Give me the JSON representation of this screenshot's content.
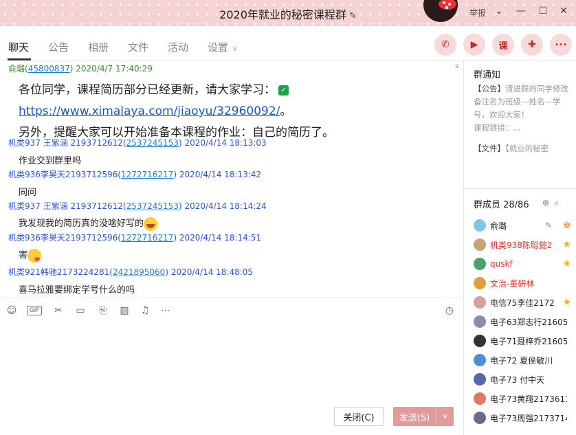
{
  "window": {
    "title": "2020年就业的秘密课程群",
    "edit_icon": "pencil-icon",
    "report_label": "举报",
    "controls": [
      "chevron-down-icon",
      "minimize-icon",
      "maximize-icon",
      "close-icon"
    ]
  },
  "tabs": [
    {
      "label": "聊天",
      "active": true
    },
    {
      "label": "公告",
      "active": false
    },
    {
      "label": "相册",
      "active": false
    },
    {
      "label": "文件",
      "active": false
    },
    {
      "label": "活动",
      "active": false
    },
    {
      "label": "设置",
      "active": false
    }
  ],
  "toolbar_buttons": [
    {
      "icon": "phone-icon",
      "glyph": "✆"
    },
    {
      "icon": "video-icon",
      "glyph": "▶"
    },
    {
      "icon": "course-icon",
      "glyph": "课"
    },
    {
      "icon": "add-chat-icon",
      "glyph": "✚"
    },
    {
      "icon": "more-icon",
      "glyph": "•••"
    }
  ],
  "messages": [
    {
      "sender": "俞璐",
      "qq": "45800837",
      "time": "2020/4/7 17:40:29",
      "line1": "各位同学，课程简历部分已经更新，请大家学习：",
      "link": "https://www.ximalaya.com/jiaoyu/32960092/",
      "line1_suffix": "。",
      "line2": "另外，提醒大家可以开始准备本课程的作业：自己的简历了。"
    },
    {
      "sender": "机类937 王紫涵 2193712612",
      "qq": "2537245153",
      "time": "2020/4/14 18:13:03",
      "text": "作业交到群里吗"
    },
    {
      "sender": "机类936李昊天2193712596",
      "qq": "1272716217",
      "time": "2020/4/14 18:13:42",
      "text": "同问"
    },
    {
      "sender": "机类937 王紫涵 2193712612",
      "qq": "2537245153",
      "time": "2020/4/14 18:14:24",
      "text": "我发现我的简历真的没啥好写的"
    },
    {
      "sender": "机类936李昊天2193712596",
      "qq": "1272716217",
      "time": "2020/4/14 18:14:51",
      "text": "害"
    },
    {
      "sender": "机类921韩驰2173224281",
      "qq": "2421895060",
      "time": "2020/4/14 18:48:05",
      "text": "喜马拉雅要绑定学号什么的吗"
    }
  ],
  "input_toolbar_icons": [
    "emoji-icon",
    "gif-icon",
    "scissors-icon",
    "folder-icon",
    "file-transfer-icon",
    "image-icon",
    "bell-icon",
    "more-options-icon",
    "history-clock-icon"
  ],
  "buttons": {
    "close": "关闭(C)",
    "send": "发送(S)"
  },
  "notice": {
    "title": "群通知",
    "announcement_tag": "【公告】",
    "announcement_text": "请进群的同学修改备注名为班级—姓名—学号，欢迎大家！",
    "announcement_more": "课程链接：...",
    "file_tag": "【文件】",
    "file_text": "【就业的秘密"
  },
  "members": {
    "title": "群成员 28/86",
    "list": [
      {
        "name": "俞璐",
        "color": "#222222",
        "badge": "owner-icon",
        "avatar": "#7ec8e3"
      },
      {
        "name": "机类938陈聪懿2",
        "color": "#d93030",
        "badge": "star-icon",
        "avatar": "#c9a27a"
      },
      {
        "name": "quskf",
        "color": "#d93030",
        "badge": "star-icon",
        "avatar": "#4aa36b"
      },
      {
        "name": "文治-董研林",
        "color": "#d93030",
        "badge": "",
        "avatar": "#e0a040"
      },
      {
        "name": "电信75李佳2172",
        "color": "#222222",
        "badge": "star-icon",
        "avatar": "#d6a0a0"
      },
      {
        "name": "电子63郑志行21605",
        "color": "#222222",
        "badge": "",
        "avatar": "#8a8fa8"
      },
      {
        "name": "电子71聂梓乔21605",
        "color": "#222222",
        "badge": "",
        "avatar": "#333333"
      },
      {
        "name": "电子72 夏侯敏川",
        "color": "#222222",
        "badge": "",
        "avatar": "#4a90d9"
      },
      {
        "name": "电子73 付中天",
        "color": "#222222",
        "badge": "",
        "avatar": "#5566aa"
      },
      {
        "name": "电子73黄翔2173611",
        "color": "#222222",
        "badge": "",
        "avatar": "#e07a5f"
      },
      {
        "name": "电子73周强2173714",
        "color": "#222222",
        "badge": "",
        "avatar": "#6b6b8a"
      }
    ]
  }
}
